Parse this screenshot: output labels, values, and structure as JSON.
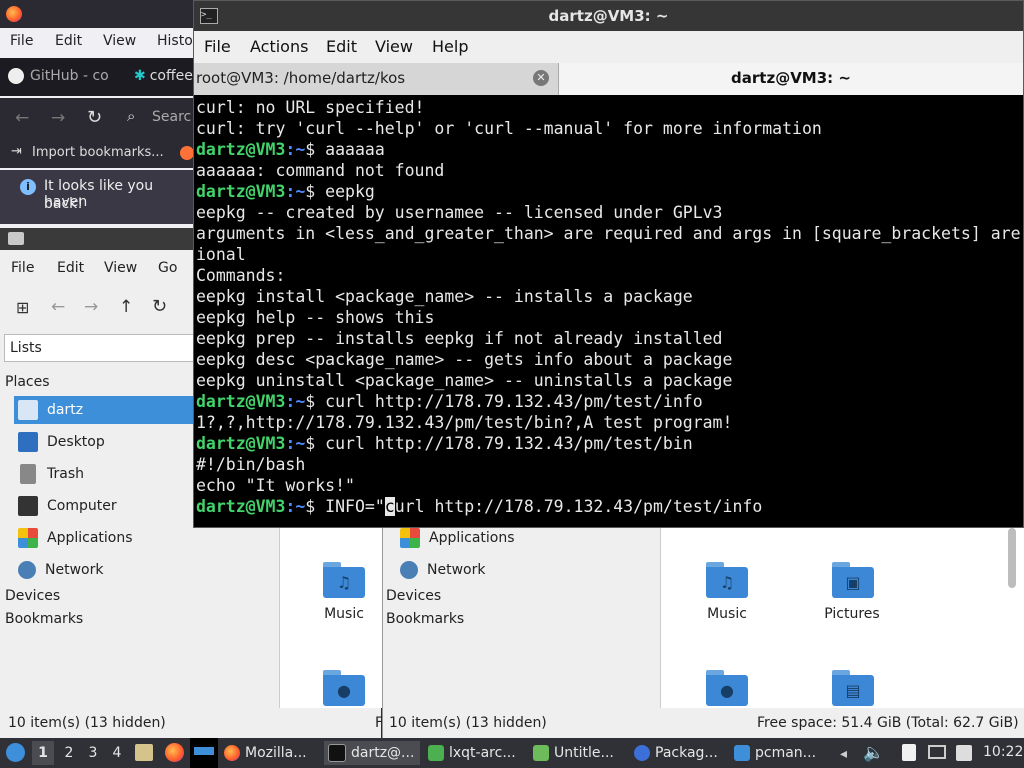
{
  "firefox": {
    "menu": [
      "File",
      "Edit",
      "View",
      "Histo"
    ],
    "tabs": [
      "GitHub - co",
      "coffee"
    ],
    "search_placeholder": "Searc",
    "bookmark": "Import bookmarks...",
    "notice_line1": "It looks like you haven",
    "notice_line2": "back!"
  },
  "filemanager_left": {
    "menu": [
      "File",
      "Edit",
      "View",
      "Go"
    ],
    "path": "Lists",
    "places_header": "Places",
    "places": [
      "dartz",
      "Desktop",
      "Trash",
      "Computer",
      "Applications",
      "Network"
    ],
    "devices": "Devices",
    "bookmarks": "Bookmarks",
    "folder": "Music",
    "status": "10 item(s) (13 hidden)",
    "status_extra": "F"
  },
  "filemanager_right": {
    "places": [
      "Applications",
      "Network"
    ],
    "devices": "Devices",
    "bookmarks": "Bookmarks",
    "folders": [
      "Music",
      "Pictures"
    ],
    "status": "10 item(s) (13 hidden)",
    "free_space": "Free space: 51.4 GiB (Total: 62.7 GiB)"
  },
  "terminal": {
    "title": "dartz@VM3: ~",
    "menu": [
      "File",
      "Actions",
      "Edit",
      "View",
      "Help"
    ],
    "tabs": [
      "root@VM3: /home/dartz/kos",
      "dartz@VM3: ~"
    ],
    "prompt_user": "dartz@VM3",
    "prompt_path": ":~",
    "prompt_sym": "$ ",
    "lines": [
      {
        "t": "out",
        "text": "curl: no URL specified!"
      },
      {
        "t": "out",
        "text": "curl: try 'curl --help' or 'curl --manual' for more information"
      },
      {
        "t": "cmd",
        "text": "aaaaaa"
      },
      {
        "t": "out",
        "text": "aaaaaa: command not found"
      },
      {
        "t": "cmd",
        "text": "eepkg"
      },
      {
        "t": "out",
        "text": "eepkg -- created by usernamee -- licensed under GPLv3"
      },
      {
        "t": "out",
        "text": "arguments in <less_and_greater_than> are required and args in [square_brackets] are opt"
      },
      {
        "t": "out",
        "text": "ional"
      },
      {
        "t": "out",
        "text": "Commands:"
      },
      {
        "t": "out",
        "text": "eepkg install <package_name> -- installs a package"
      },
      {
        "t": "out",
        "text": "eepkg help -- shows this"
      },
      {
        "t": "out",
        "text": "eepkg prep -- installs eepkg if not already installed"
      },
      {
        "t": "out",
        "text": "eepkg desc <package_name> -- gets info about a package"
      },
      {
        "t": "out",
        "text": "eepkg uninstall <package_name> -- uninstalls a package"
      },
      {
        "t": "cmd",
        "text": "curl http://178.79.132.43/pm/test/info"
      },
      {
        "t": "out",
        "text": "1?,?,http://178.79.132.43/pm/test/bin?,A test program!"
      },
      {
        "t": "cmd",
        "text": "curl http://178.79.132.43/pm/test/bin"
      },
      {
        "t": "out",
        "text": "#!/bin/bash"
      },
      {
        "t": "out",
        "text": "echo \"It works!\""
      }
    ],
    "current_before": "INFO=\"",
    "current_cursor": "c",
    "current_after": "url http://178.79.132.43/pm/test/info"
  },
  "taskbar": {
    "desktops": [
      "1",
      "2",
      "3",
      "4"
    ],
    "tasks": [
      "Mozilla...",
      "dartz@...",
      "lxqt-arc...",
      "Untitle...",
      "Packag...",
      "pcman..."
    ],
    "clock": "10:22"
  }
}
